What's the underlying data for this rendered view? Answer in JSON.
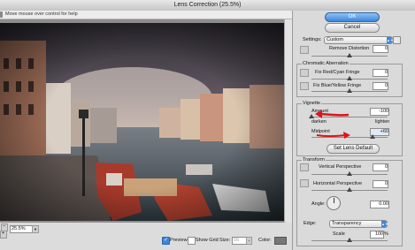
{
  "window": {
    "title": "Lens Correction (25.5%)"
  },
  "help_text": "Move mouse over control for help",
  "zoom": {
    "minus_label": "–",
    "plus_label": "+",
    "value": "25.5%"
  },
  "preview": {
    "label": "Preview",
    "checked": true
  },
  "show_grid": {
    "label": "Show Grid",
    "checked": false
  },
  "grid_size": {
    "label": "Size:",
    "value": "16"
  },
  "grid_color": {
    "label": "Color:",
    "swatch": "#777777"
  },
  "buttons": {
    "ok": "OK",
    "cancel": "Cancel"
  },
  "settings": {
    "label": "Settings:",
    "value": "Custom"
  },
  "remove_distortion": {
    "label": "Remove Distortion",
    "value": "0",
    "level": 0.5
  },
  "chromatic": {
    "title": "Chromatic Aberration",
    "red_cyan": {
      "label": "Fix Red/Cyan Fringe",
      "value": "0",
      "level": 0.5
    },
    "blue_yellow": {
      "label": "Fix Blue/Yellow Fringe",
      "value": "0",
      "level": 0.5
    }
  },
  "vignette": {
    "title": "Vignette",
    "amount": {
      "label": "Amount",
      "value": "-100",
      "left_label": "darken",
      "right_label": "lighten",
      "level": 0.0
    },
    "midpoint": {
      "label": "Midpoint",
      "value": "+60",
      "level": 0.8
    },
    "set_default": "Set Lens Default"
  },
  "transform": {
    "title": "Transform",
    "vertical": {
      "label": "Vertical Perspective",
      "value": "0",
      "level": 0.5
    },
    "horizontal": {
      "label": "Horizontal Perspective",
      "value": "0",
      "level": 0.5
    },
    "angle": {
      "label": "Angle:",
      "value": "0.00"
    },
    "edge": {
      "label": "Edge:",
      "value": "Transparency"
    },
    "scale": {
      "label": "Scale",
      "value": "100",
      "unit": "%",
      "level": 0.5
    }
  },
  "colors": {
    "accent": "#3d86dc",
    "annotation_arrow": "#d9161b"
  }
}
